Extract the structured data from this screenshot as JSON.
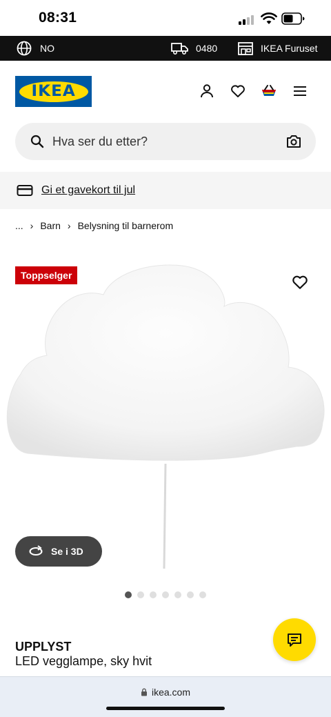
{
  "status_bar": {
    "time": "08:31"
  },
  "top_strip": {
    "language": "NO",
    "postcode": "0480",
    "store": "IKEA Furuset"
  },
  "header": {
    "logo_text": "IKEA",
    "icons": [
      "user-icon",
      "heart-icon",
      "basket-icon",
      "menu-icon"
    ]
  },
  "search": {
    "placeholder": "Hva ser du etter?"
  },
  "banner": {
    "gift_text": "Gi et gavekort til jul"
  },
  "breadcrumb": {
    "ellipsis": "...",
    "items": [
      "Barn",
      "Belysning til barnerom"
    ]
  },
  "product": {
    "badge": "Toppselger",
    "view_3d_label": "Se i 3D",
    "image_count": 7,
    "active_image": 1,
    "name": "UPPLYST",
    "description": "LED vegglampe, sky hvit"
  },
  "browser": {
    "url": "ikea.com"
  },
  "colors": {
    "ikea_blue": "#0058a3",
    "ikea_yellow": "#ffdb00",
    "badge_red": "#cc0008",
    "strip": "#111111"
  }
}
